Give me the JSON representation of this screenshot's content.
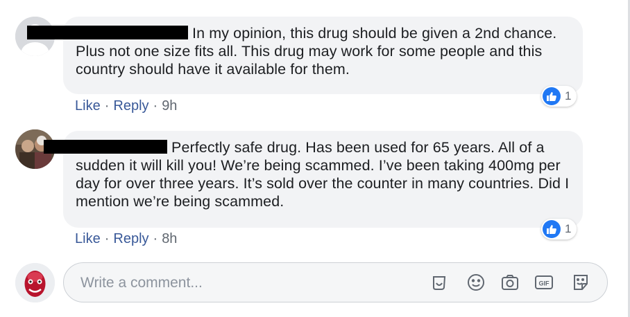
{
  "comments": [
    {
      "text": "In my opinion, this drug should be given a 2nd chance. Plus not one size fits all. This drug may work for some people and this country should have it available for them.",
      "actions": {
        "like": "Like",
        "reply": "Reply",
        "time": "9h"
      },
      "reactions": {
        "count": "1",
        "type": "like-icon"
      }
    },
    {
      "text": "Perfectly safe drug. Has been used for 65 years. All of a sudden it will kill you! We’re being scammed. I’ve been taking 400mg per day for over three years. It’s sold over the counter in many countries. Did I mention we’re being scammed.",
      "actions": {
        "like": "Like",
        "reply": "Reply",
        "time": "8h"
      },
      "reactions": {
        "count": "1",
        "type": "like-icon"
      }
    }
  ],
  "separator": "·",
  "composer": {
    "placeholder": "Write a comment...",
    "icons": [
      "sticker-icon",
      "emoji-icon",
      "camera-icon",
      "gif-icon",
      "sticker-smile-icon"
    ],
    "gif_label": "GIF"
  },
  "colors": {
    "link": "#385898",
    "bubble": "#f2f3f5",
    "like_blue": "#2078f4",
    "meta": "#606770"
  }
}
